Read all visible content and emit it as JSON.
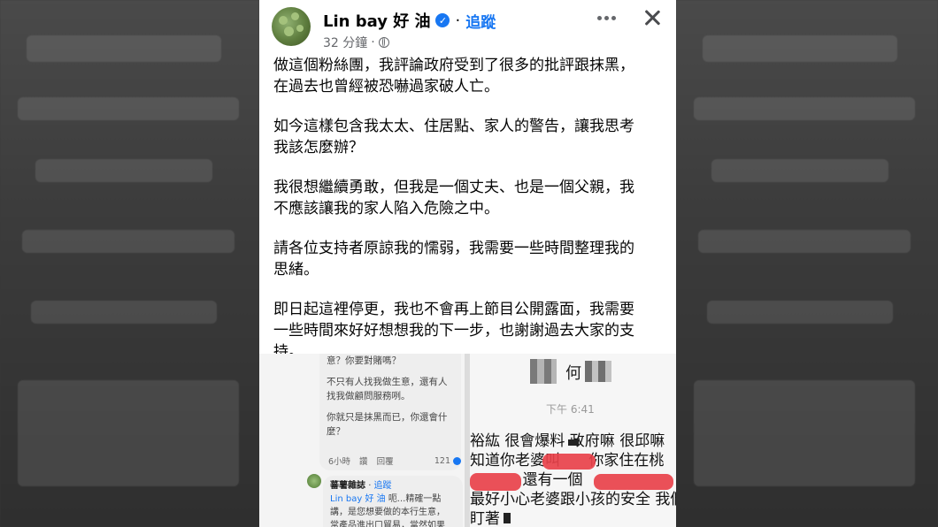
{
  "post": {
    "author": "Lin bay 好 油",
    "separator": "·",
    "follow_label": "追蹤",
    "time": "32 分鐘",
    "time_separator": "·",
    "paragraphs": [
      "做這個粉絲團，我評論政府受到了很多的批評跟抹黑，\n在過去也曾經被恐嚇過家破人亡。",
      "如今這樣包含我太太、住居點、家人的警告，讓我思考\n我該怎麼辦？",
      "我很想繼續勇敢，但我是一個丈夫、也是一個父親，我\n不應該讓我的家人陷入危險之中。",
      "請各位支持者原諒我的懦弱，我需要一些時間整理我的\n思緒。",
      "即日起這裡停更，我也不會再上節目公開露面，我需要\n一些時間來好好想想我的下一步，也謝謝過去大家的支\n持。"
    ]
  },
  "comment_screenshot": {
    "bubble_lines": [
      "意？你要對賭嗎？",
      "不只有人找我做生意，還有人\n找我做顧問服務咧。",
      "你就只是抹黑而已，你還會什\n麼？"
    ],
    "reply_time": "6小時",
    "reply_like": "讚",
    "reply_reply": "回覆",
    "reply_count": "121",
    "reply2_name": "蕃薯雜誌",
    "reply2_follow": "追蹤",
    "reply2_tag": "Lin bay 好 油",
    "reply2_text": "呃...精確一點\n講，是您想要做的本行生意，\n常產品進出口貿易，當然如果"
  },
  "chat_screenshot": {
    "contact_name": "何",
    "time": "下午 6:41",
    "message_lines": "裕紘 很會爆料 政府嘛 很邱嘛\n知道你老婆叫      你家住在桃\n           還有一個\n最好小心老婆跟小孩的安全 我們\n盯著"
  },
  "colors": {
    "accent": "#1877f2",
    "text": "#050505",
    "secondary": "#65676b",
    "redaction": "#e8414a"
  },
  "icons": {
    "verified": "verified-badge-icon",
    "globe": "globe-icon",
    "more": "more-horizontal-icon",
    "close": "close-icon"
  }
}
